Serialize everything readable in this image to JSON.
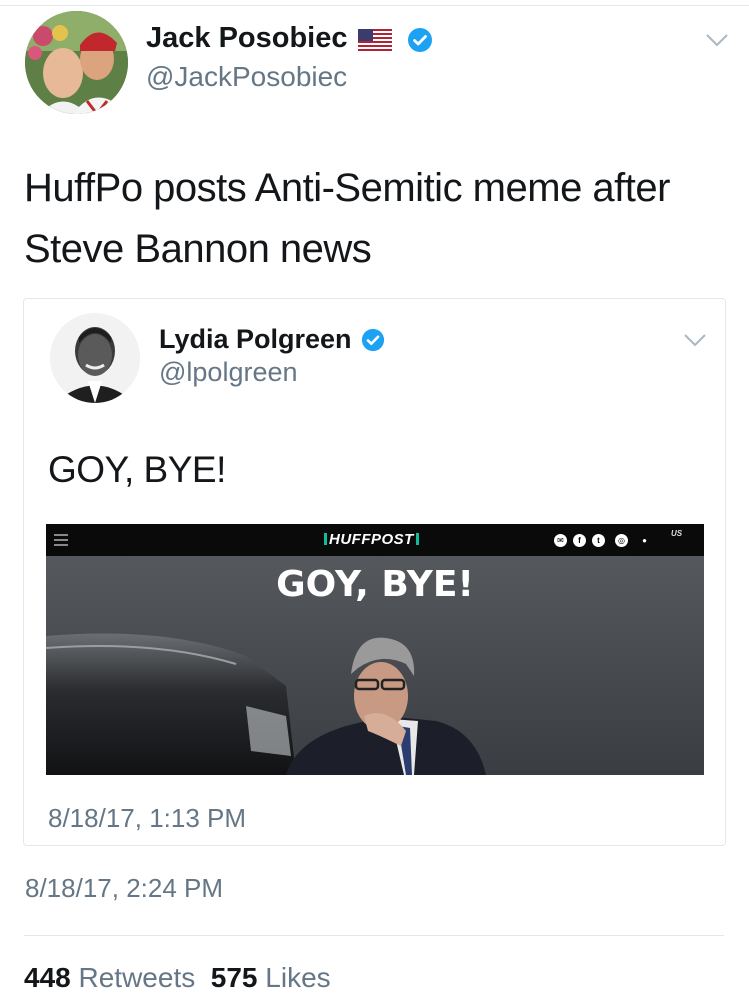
{
  "tweet": {
    "author_name": "Jack Posobiec",
    "author_flag_icon": "us-flag-icon",
    "author_verified_icon": "verified-badge-icon",
    "author_handle": "@JackPosobiec",
    "text": "HuffPo posts Anti-Semitic meme after Steve Bannon news",
    "timestamp": "8/18/17, 2:24 PM",
    "retweets_count": "448",
    "retweets_label": "Retweets",
    "likes_count": "575",
    "likes_label": "Likes"
  },
  "quoted_tweet": {
    "author_name": "Lydia Polgreen",
    "author_verified_icon": "verified-badge-icon",
    "author_handle": "@lpolgreen",
    "text": "GOY, BYE!",
    "timestamp": "8/18/17, 1:13 PM",
    "image": {
      "site_logo": "HUFFPOST",
      "edition_label": "US",
      "headline": "GOY, BYE!",
      "social_icons": [
        "email-icon",
        "facebook-icon",
        "twitter-icon",
        "instagram-icon",
        "notification-icon"
      ]
    }
  },
  "colors": {
    "text_primary": "#14171a",
    "text_secondary": "#657786",
    "verified_blue": "#1da1f2",
    "divider": "#e1e8ed",
    "huffpost_accent": "#0dbe98"
  }
}
